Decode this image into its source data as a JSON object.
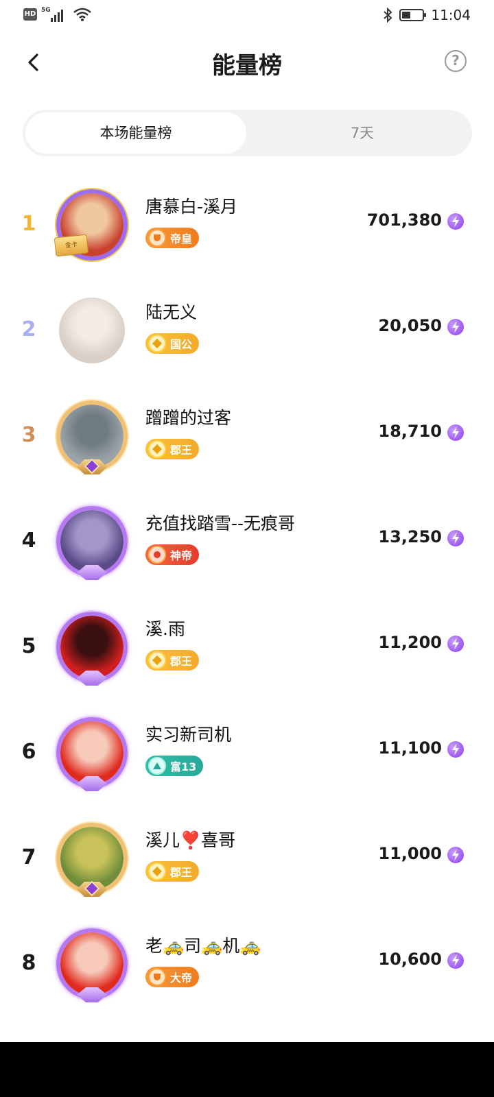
{
  "status_bar": {
    "hd": "HD",
    "network": "5G",
    "time": "11:04",
    "icons": [
      "hd-icon",
      "signal-icon",
      "wifi-icon",
      "bluetooth-icon",
      "battery-icon"
    ]
  },
  "header": {
    "title": "能量榜",
    "help": "?"
  },
  "tabs": [
    {
      "label": "本场能量榜",
      "active": true
    },
    {
      "label": "7天",
      "active": false
    }
  ],
  "ranking": [
    {
      "rank": "1",
      "name": "唐慕白-溪月",
      "badge": "帝皇",
      "badge_style": "orange",
      "score": "701,380",
      "avatar_colors": [
        "#c9412f",
        "#f0c8a0"
      ],
      "frame": "violet1",
      "gold_card": "金卡"
    },
    {
      "rank": "2",
      "name": "陆无义",
      "badge": "国公",
      "badge_style": "gold",
      "score": "20,050",
      "avatar_colors": [
        "#d9cfc6",
        "#f3ece6"
      ],
      "frame": "none"
    },
    {
      "rank": "3",
      "name": "蹭蹭的过客",
      "badge": "郡王",
      "badge_style": "gold",
      "score": "18,710",
      "avatar_colors": [
        "#9aa3a8",
        "#6f7b82"
      ],
      "frame": "gold"
    },
    {
      "rank": "4",
      "name": "充值找踏雪--无痕哥",
      "badge": "神帝",
      "badge_style": "red",
      "score": "13,250",
      "avatar_colors": [
        "#5a4a88",
        "#a397c9"
      ],
      "frame": "purple"
    },
    {
      "rank": "5",
      "name": "溪.雨",
      "badge": "郡王",
      "badge_style": "gold",
      "score": "11,200",
      "avatar_colors": [
        "#d11f1f",
        "#3a1010"
      ],
      "frame": "purple"
    },
    {
      "rank": "6",
      "name": "实习新司机",
      "badge": "富13",
      "badge_style": "teal",
      "score": "11,100",
      "avatar_colors": [
        "#e02a1e",
        "#f6c9b8"
      ],
      "frame": "purple"
    },
    {
      "rank": "7",
      "name": "溪儿❣️喜哥",
      "badge": "郡王",
      "badge_style": "gold",
      "score": "11,000",
      "avatar_colors": [
        "#6f8d3a",
        "#c9c25a"
      ],
      "frame": "gold"
    },
    {
      "rank": "8",
      "name": "老🚕司🚕机🚕",
      "badge": "大帝",
      "badge_style": "orange",
      "score": "10,600",
      "avatar_colors": [
        "#e02a1e",
        "#f6c9b8"
      ],
      "frame": "purple"
    }
  ],
  "colors": {
    "rank1": "#f2b533",
    "rank2": "#a9aef0",
    "rank3": "#d0905a",
    "energy": "#8d3be8"
  }
}
